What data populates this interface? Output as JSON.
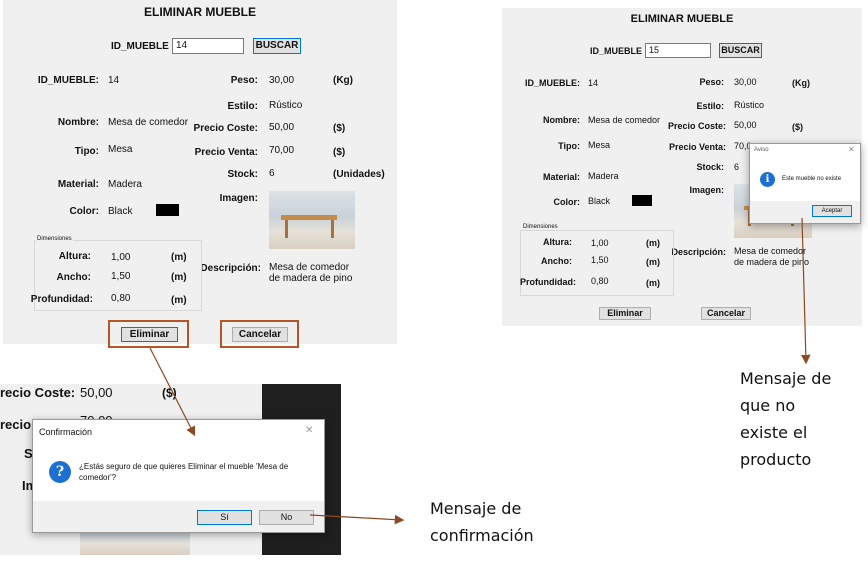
{
  "panel1": {
    "title": "ELIMINAR MUEBLE",
    "search": {
      "label": "ID_MUEBLE",
      "value": "14",
      "button": "BUSCAR"
    },
    "fields": {
      "id_label": "ID_MUEBLE:",
      "id_value": "14",
      "nombre_label": "Nombre:",
      "nombre_value": "Mesa de comedor",
      "tipo_label": "Tipo:",
      "tipo_value": "Mesa",
      "material_label": "Material:",
      "material_value": "Madera",
      "color_label": "Color:",
      "color_value": "Black",
      "peso_label": "Peso:",
      "peso_value": "30,00",
      "peso_unit": "(Kg)",
      "estilo_label": "Estilo:",
      "estilo_value": "Rústico",
      "coste_label": "Precio Coste:",
      "coste_value": "50,00",
      "coste_unit": "($)",
      "venta_label": "Precio Venta:",
      "venta_value": "70,00",
      "venta_unit": "($)",
      "stock_label": "Stock:",
      "stock_value": "6",
      "stock_unit": "(Unidades)",
      "imagen_label": "Imagen:",
      "desc_label": "Descripción:",
      "desc_line1": "Mesa de comedor",
      "desc_line2": "de madera de pino"
    },
    "dimensions": {
      "title": "Dimensiones",
      "altura_label": "Altura:",
      "altura_value": "1,00",
      "altura_unit": "(m)",
      "ancho_label": "Ancho:",
      "ancho_value": "1,50",
      "ancho_unit": "(m)",
      "prof_label": "Profundidad:",
      "prof_value": "0,80",
      "prof_unit": "(m)"
    },
    "buttons": {
      "eliminar": "Eliminar",
      "cancelar": "Cancelar"
    }
  },
  "panel2": {
    "title": "ELIMINAR MUEBLE",
    "search": {
      "label": "ID_MUEBLE",
      "value": "15",
      "button": "BUSCAR"
    },
    "fields": {
      "id_label": "ID_MUEBLE:",
      "id_value": "14",
      "nombre_label": "Nombre:",
      "nombre_value": "Mesa de comedor",
      "tipo_label": "Tipo:",
      "tipo_value": "Mesa",
      "material_label": "Material:",
      "material_value": "Madera",
      "color_label": "Color:",
      "color_value": "Black",
      "peso_label": "Peso:",
      "peso_value": "30,00",
      "peso_unit": "(Kg)",
      "estilo_label": "Estilo:",
      "estilo_value": "Rústico",
      "coste_label": "Precio Coste:",
      "coste_value": "50,00",
      "coste_unit": "($)",
      "venta_label": "Precio Venta:",
      "venta_value": "70,0",
      "stock_label": "Stock:",
      "stock_value": "6",
      "imagen_label": "Imagen:",
      "desc_label": "Descripción:",
      "desc_line1": "Mesa de comedor",
      "desc_line2": "de madera de pino"
    },
    "dimensions": {
      "title": "Dimensiones",
      "altura_label": "Altura:",
      "altura_value": "1,00",
      "altura_unit": "(m)",
      "ancho_label": "Ancho:",
      "ancho_value": "1,50",
      "ancho_unit": "(m)",
      "prof_label": "Profundidad:",
      "prof_value": "0,80",
      "prof_unit": "(m)"
    },
    "buttons": {
      "eliminar": "Eliminar",
      "cancelar": "Cancelar"
    },
    "aviso": {
      "title": "Aviso",
      "message": "Este mueble no existe",
      "ok": "Aceptar",
      "icon": "info-icon"
    }
  },
  "panel3": {
    "bg_coste_label": "recio Coste:",
    "bg_coste_value": "50,00",
    "bg_coste_unit": "($)",
    "bg_left_fragment": "recio",
    "bg_value_fragment": "70,00",
    "bg_s": "S",
    "bg_im": "Im",
    "dialog": {
      "title": "Confirmación",
      "message_line1": "¿Estás seguro de que quieres Eliminar el mueble 'Mesa de",
      "message_line2": "comedor'?",
      "yes": "Sí",
      "no": "No",
      "icon": "question-icon"
    }
  },
  "annotations": {
    "right_caption": [
      "Mensaje de",
      "que no",
      "existe el",
      "producto"
    ],
    "bottom_caption": [
      "Mensaje de",
      "confirmación"
    ],
    "highlight_color": "#b5562a"
  }
}
